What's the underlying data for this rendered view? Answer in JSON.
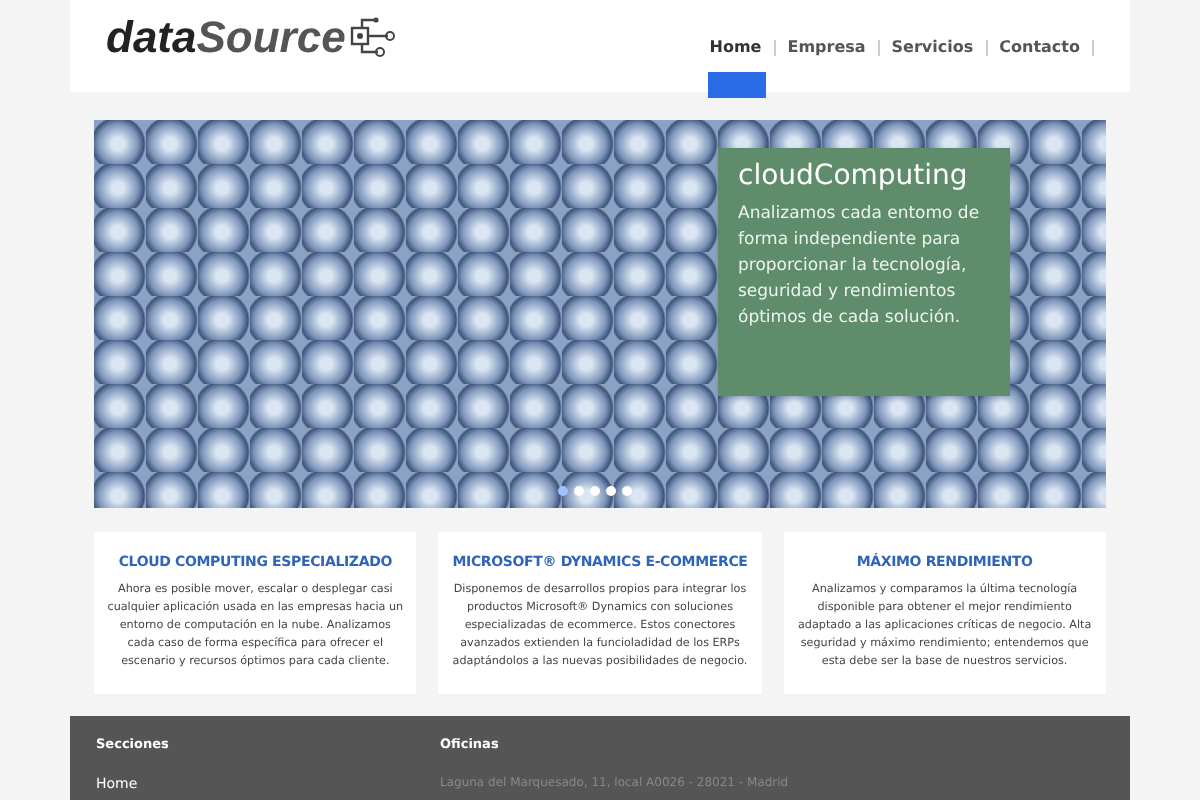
{
  "logo": {
    "text_bold": "data",
    "text_light": "Source"
  },
  "nav": [
    {
      "label": "Home",
      "selected": true
    },
    {
      "label": "Empresa",
      "selected": false
    },
    {
      "label": "Servicios",
      "selected": false
    },
    {
      "label": "Contacto",
      "selected": false
    }
  ],
  "hero": {
    "title": "cloudComputing",
    "text": "Analizamos cada entomo de forma independiente para proporcionar la tecnología, seguridad y rendimientos óptimos de cada solución.",
    "dots": [
      {
        "selected": true
      },
      {
        "selected": false
      },
      {
        "selected": false
      },
      {
        "selected": false
      },
      {
        "selected": false
      }
    ]
  },
  "features": [
    {
      "title": "CLOUD COMPUTING ESPECIALIZADO",
      "text": "Ahora es posible mover, escalar o desplegar casi cualquier aplicación usada en las empresas hacia un entorno de computación en la nube. Analizamos cada caso de forma específica para ofrecer el escenario y recursos óptimos para cada cliente."
    },
    {
      "title": "MICROSOFT® DYNAMICS E-COMMERCE",
      "text": "Disponemos de desarrollos propios para integrar los productos Microsoft® Dynamics con soluciones especializadas de ecommerce. Estos conectores avanzados extienden la funcioladidad de los ERPs adaptándolos a las nuevas posibilidades de negocio."
    },
    {
      "title": "MÁXIMO RENDIMIENTO",
      "text": "Analizamos y comparamos la última tecnología disponible para obtener el mejor rendimiento adaptado a las aplicaciones críticas de negocio. Alta seguridad y máximo rendimiento; entendemos que esta debe ser la base de nuestros servicios."
    }
  ],
  "footer": {
    "sections_title": "Secciones",
    "links": [
      "Home"
    ],
    "offices_title": "Oficinas",
    "addresses": [
      "Laguna del Marquesado, 11, local A0026 - 28021 - Madrid"
    ]
  }
}
